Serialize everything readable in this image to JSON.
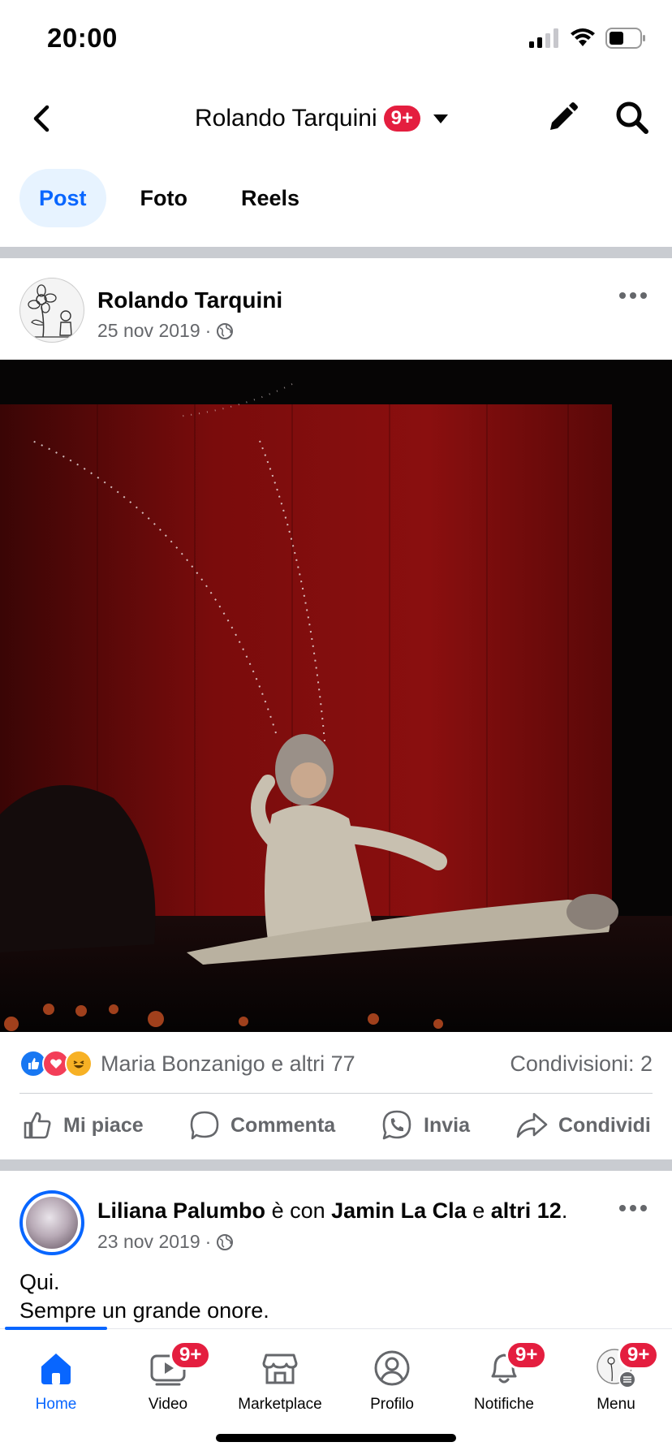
{
  "status_bar": {
    "time": "20:00",
    "icons": [
      "signal-icon",
      "wifi-icon",
      "battery-icon"
    ]
  },
  "header": {
    "title": "Rolando Tarquini",
    "badge": "9+",
    "icons": [
      "back-arrow-icon",
      "caret-down-icon",
      "edit-pencil-icon",
      "search-icon"
    ]
  },
  "tabs": [
    {
      "label": "Post",
      "active": true
    },
    {
      "label": "Foto",
      "active": false
    },
    {
      "label": "Reels",
      "active": false
    }
  ],
  "post": {
    "author": "Rolando Tarquini",
    "date": "25 nov 2019",
    "separator": "·",
    "privacy_icon": "globe-icon",
    "photo_description_icon": "theatre-photo",
    "reactions": [
      "like",
      "love",
      "haha"
    ],
    "reactions_text": "Maria Bonzanigo e altri 77",
    "shares_text": "Condivisioni: 2",
    "actions": [
      "Mi piace",
      "Commenta",
      "Invia",
      "Condividi"
    ]
  },
  "post2": {
    "author": "Liliana Palumbo",
    "with_word": "è con",
    "tagged": "Jamin La Cla",
    "and_word": "e",
    "others": "altri 12",
    "period": ".",
    "date": "23 nov 2019",
    "separator": "·",
    "line1": "Qui.",
    "line2": "Sempre un grande onore."
  },
  "bottom_nav": [
    {
      "label": "Home",
      "active": true,
      "badge": ""
    },
    {
      "label": "Video",
      "active": false,
      "badge": "9+"
    },
    {
      "label": "Marketplace",
      "active": false,
      "badge": ""
    },
    {
      "label": "Profilo",
      "active": false,
      "badge": ""
    },
    {
      "label": "Notifiche",
      "active": false,
      "badge": "9+"
    },
    {
      "label": "Menu",
      "active": false,
      "badge": "9+"
    }
  ],
  "colors": {
    "accent": "#0866ff",
    "badge": "#e41e3f",
    "secondary_text": "#65676b",
    "divider": "#c9ccd1"
  }
}
